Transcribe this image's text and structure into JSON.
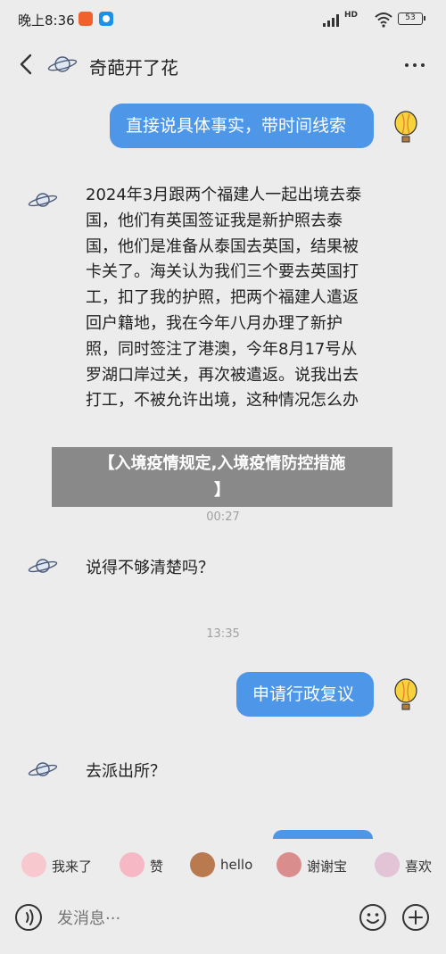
{
  "status_bar": {
    "time": "晚上8:36",
    "network": "HD",
    "battery": "53"
  },
  "header": {
    "title": "奇葩开了花"
  },
  "messages": [
    {
      "from": "user",
      "text": "直接说具体事实，带时间线索"
    },
    {
      "from": "bot",
      "text": "2024年3月跟两个福建人一起出境去泰国，他们有英国签证我是新护照去泰国，他们是准备从泰国去英国，结果被卡关了。海关认为我们三个要去英国打工，扣了我的护照，把两个福建人遣返回户籍地，我在今年八月办理了新护照，同时签注了港澳，今年8月17号从罗湖口岸过关，再次被遣返。说我出去打工，不被允许出境，这种情况怎么办"
    },
    {
      "timestamp": "00:27"
    },
    {
      "from": "bot",
      "text": "说得不够清楚吗？"
    },
    {
      "timestamp": "13:35"
    },
    {
      "from": "user",
      "text": "申请行政复议"
    },
    {
      "from": "bot",
      "text": "去派出所？"
    }
  ],
  "overlay": {
    "line1": "【入境疫情规定,入境疫情防控措施",
    "line2": "】"
  },
  "quick_replies": [
    "我来了",
    "赞",
    "hello",
    "谢谢宝",
    "喜欢"
  ],
  "input": {
    "placeholder": "发消息···"
  },
  "colors": {
    "background": "#ececec",
    "user_bubble": "#4e96e8",
    "overlay": "#808080"
  }
}
